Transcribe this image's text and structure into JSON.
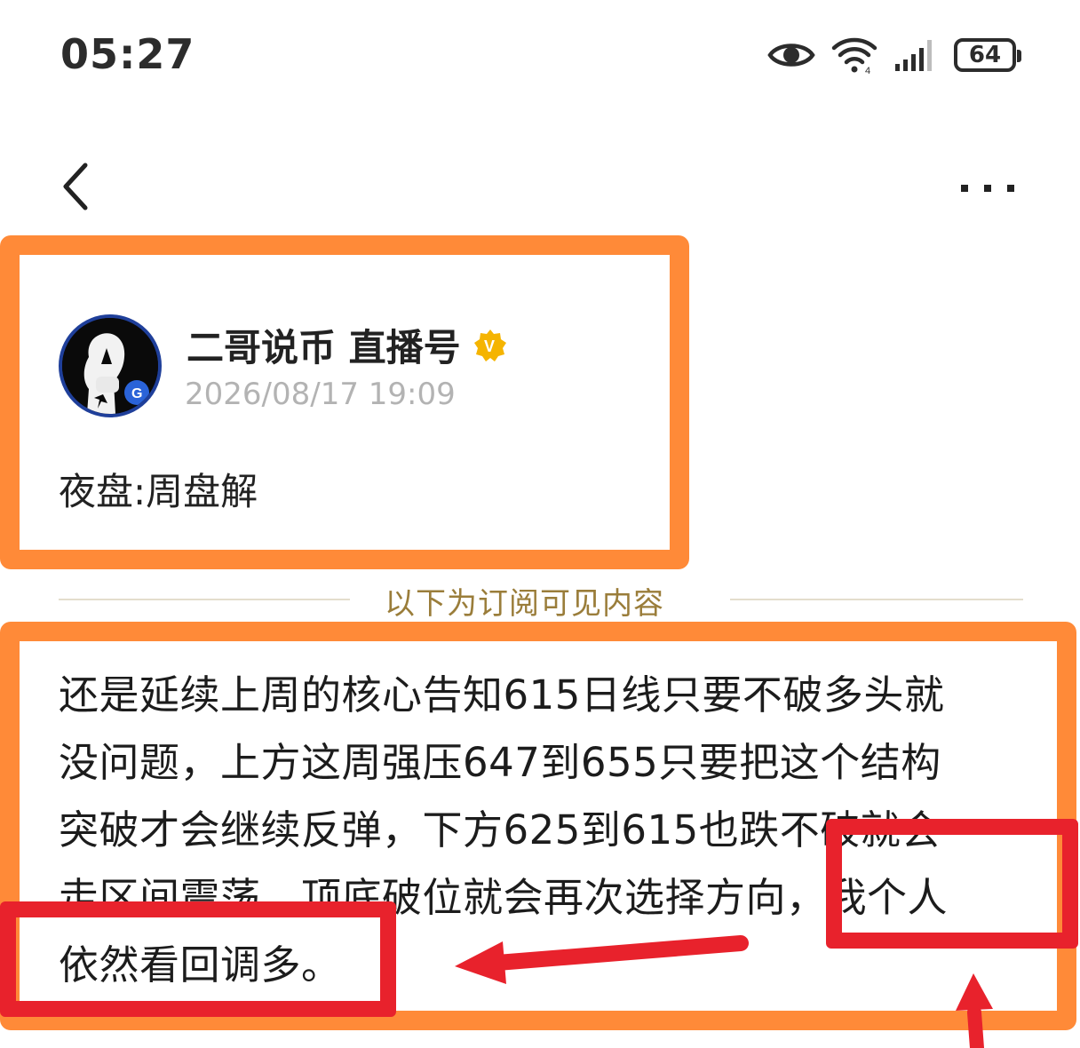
{
  "status_bar": {
    "time": "05:27",
    "battery_level": "64",
    "icons": [
      "eye-icon",
      "wifi-icon",
      "signal-icon",
      "battery-icon"
    ]
  },
  "nav": {
    "back_icon": "chevron-left-icon",
    "more_icon": "more-dots-icon"
  },
  "post": {
    "author": "二哥说币 直播号",
    "verified_badge": "V",
    "date": "2026/08/17 19:09",
    "title": "夜盘:周盘解"
  },
  "divider": {
    "label": "以下为订阅可见内容"
  },
  "content": {
    "lines": [
      "还是延续上周的核心告知615日线只要不破多头就",
      "没问题，上方这周强压647到655只要把这个结构",
      "突破才会继续反弹，下方625到615也跌不破就会",
      "走区间震荡。顶底破位就会再次选择方向，我个人",
      "依然看回调多。"
    ]
  },
  "colors": {
    "highlight_orange": "#ff8a38",
    "annotation_red": "#e8222c",
    "divider_gold": "#9a7d3a",
    "verified_gold": "#f5b400"
  }
}
